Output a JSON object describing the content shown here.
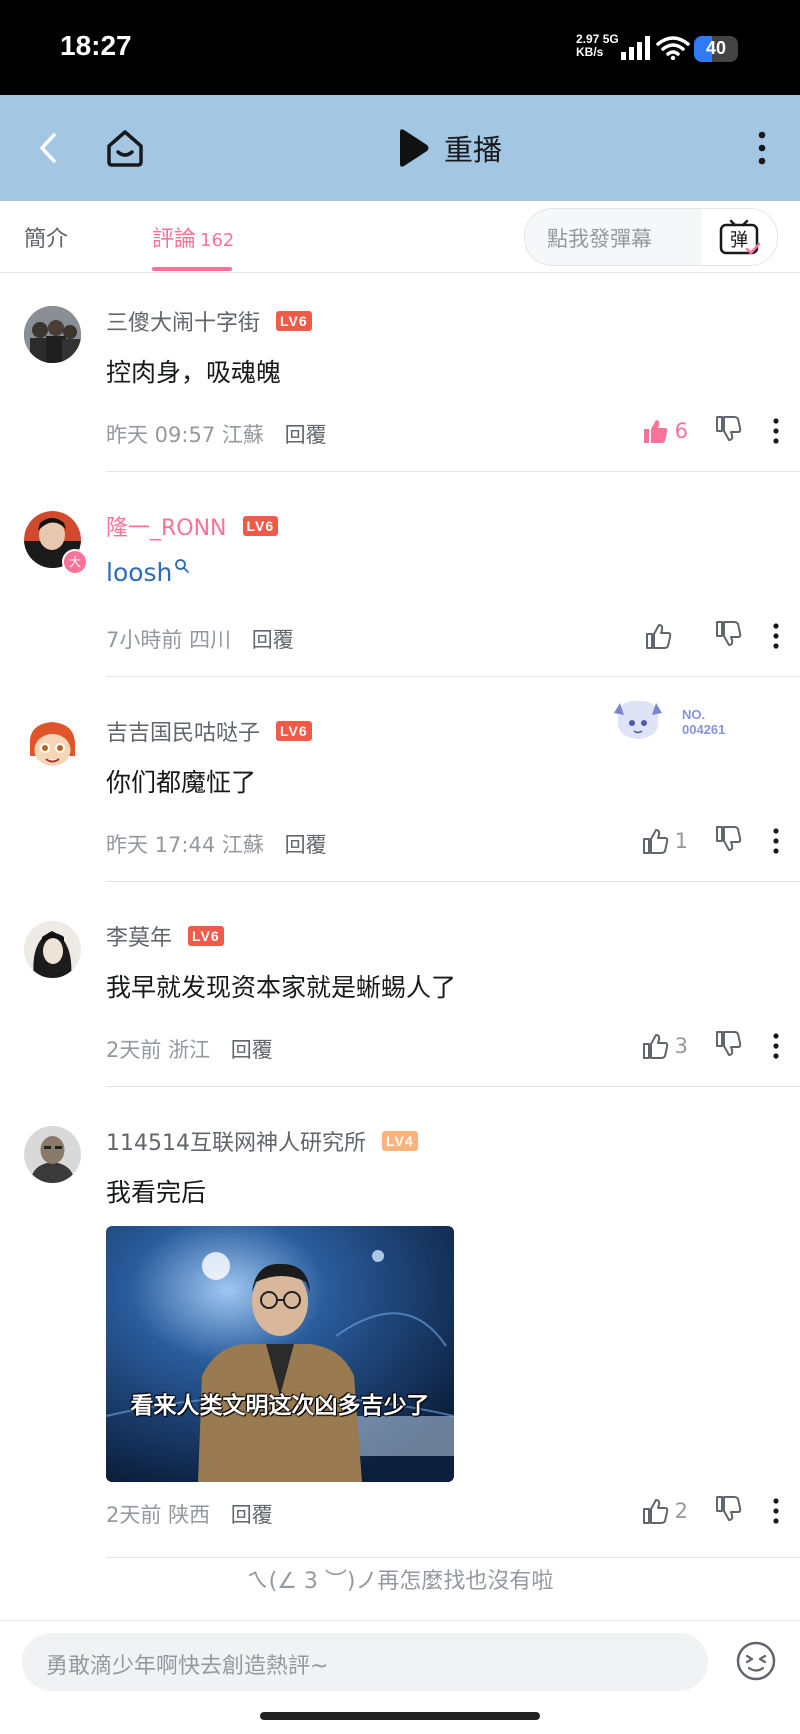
{
  "status_bar": {
    "time": "18:27",
    "net_speed": "2.97",
    "net_unit": "KB/s",
    "net_type": "5G",
    "battery": "40"
  },
  "header": {
    "back_icon": "chevron-left-icon",
    "home_icon": "home-icon",
    "play_label": "重播",
    "more_icon": "more-vertical-icon"
  },
  "tabs": {
    "intro": "簡介",
    "comments": "評論",
    "comments_count": "162",
    "danmaku_placeholder": "點我發彈幕",
    "danmaku_icon_char": "弹"
  },
  "colors": {
    "accent": "#fb7299",
    "header_bg": "#a3c6e2",
    "lv6": "#f05a48",
    "lv4": "#ffb37c"
  },
  "comments": [
    {
      "name": "三傻大闹十字街",
      "level": "LV6",
      "text": "控肉身，吸魂魄",
      "time": "昨天 09:57",
      "location": "江蘇",
      "reply": "回覆",
      "likes": "6",
      "liked": true
    },
    {
      "name": "隆一_RONN",
      "level": "LV6",
      "text": "loosh",
      "time": "7小時前",
      "location": "四川",
      "reply": "回覆",
      "likes": "",
      "avatar_badge": "大"
    },
    {
      "name": "吉吉国民咕哒子",
      "level": "LV6",
      "text": "你们都魔怔了",
      "time": "昨天 17:44",
      "location": "江蘇",
      "reply": "回覆",
      "likes": "1",
      "fan_badge": "NO.\n004261"
    },
    {
      "name": "李莫年",
      "level": "LV6",
      "text": "我早就发现资本家就是蜥蜴人了",
      "time": "2天前",
      "location": "浙江",
      "reply": "回覆",
      "likes": "3"
    },
    {
      "name": "114514互联网神人研究所",
      "level": "LV4",
      "text": "我看完后",
      "image_caption": "看来人类文明这次凶多吉少了",
      "time": "2天前",
      "location": "陕西",
      "reply": "回覆",
      "likes": "2"
    }
  ],
  "end_tip": "ㄟ(∠ 3 ︶)ノ再怎麼找也沒有啦",
  "input": {
    "placeholder": "勇敢滴少年啊快去創造熱評~",
    "emoji_icon": "emoji-icon"
  }
}
